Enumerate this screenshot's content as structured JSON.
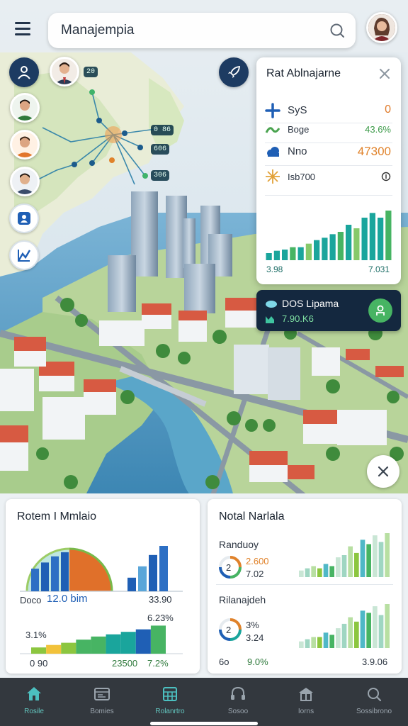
{
  "header": {
    "search_value": "Manajempia",
    "search_placeholder": "Manajempia"
  },
  "map": {
    "route_tags": [
      "20",
      "0 86",
      "606",
      "306"
    ],
    "side_buttons": [
      "pin-icon",
      "analytics-icon"
    ]
  },
  "info_panel": {
    "title": "Rat Ablnajarne",
    "rows": [
      {
        "icon": "cross-icon",
        "label": "SyS",
        "value": "0",
        "color": "#e07b2a"
      },
      {
        "icon": "trend-icon",
        "label": "Boge",
        "value": "43.6%",
        "color": "#3d9b4a"
      },
      {
        "icon": "cloud-icon",
        "label": "Nno",
        "value": "47300",
        "color": "#e0822a"
      },
      {
        "icon": "star-icon",
        "label": "Isb700",
        "value": "0",
        "color": "#333333"
      }
    ],
    "foot_left": "3.98",
    "foot_right": "7.031",
    "chart": [
      12,
      16,
      18,
      22,
      22,
      28,
      34,
      38,
      44,
      48,
      60,
      54,
      72,
      80,
      72,
      84
    ]
  },
  "dark_card": {
    "title": "DOS Lipama",
    "subtitle": "7.90.K6"
  },
  "left_card": {
    "title": "Rotem I Mmlaio",
    "caption_left": "Doco",
    "caption_mid": "12.0 bim",
    "caption_right": "33.90",
    "area_pct": "6.23%",
    "area_left": "3.1%",
    "foot_1": "0 90",
    "foot_2": "23500",
    "foot_3": "7.2%",
    "semi_bars": [
      0.55,
      0.7,
      0.85,
      0.95
    ],
    "right_bars": [
      0.3,
      0.55,
      0.8,
      1.0
    ],
    "area_values": [
      0.2,
      0.28,
      0.35,
      0.45,
      0.55,
      0.62,
      0.7,
      0.78,
      0.9
    ]
  },
  "right_card": {
    "title": "Notal Narlala",
    "section1_title": "Randuoy",
    "s1_ring": "2",
    "s1_val1": "2.600",
    "s1_val2": "7.02",
    "section2_title": "Rilanajdeh",
    "s2_ring": "2",
    "s2_val1": "3%",
    "s2_val2": "3.24",
    "foot_left": "6o",
    "foot_mid": "9.0%",
    "foot_right": "3.9.06",
    "bars1": [
      0.15,
      0.2,
      0.25,
      0.2,
      0.3,
      0.25,
      0.45,
      0.5,
      0.7,
      0.55,
      0.85,
      0.75,
      0.95,
      0.8,
      1.0
    ],
    "bars2": [
      0.15,
      0.2,
      0.25,
      0.25,
      0.35,
      0.3,
      0.45,
      0.55,
      0.7,
      0.6,
      0.85,
      0.8,
      0.95,
      0.75,
      1.0
    ]
  },
  "nav": {
    "items": [
      {
        "label": "Rosile",
        "icon": "home-icon"
      },
      {
        "label": "Bomies",
        "icon": "browser-icon"
      },
      {
        "label": "Rolanrtro",
        "icon": "grid-icon"
      },
      {
        "label": "Sosoo",
        "icon": "headset-icon"
      },
      {
        "label": "Iorns",
        "icon": "building-icon"
      },
      {
        "label": "Sossibrono",
        "icon": "search-icon"
      }
    ],
    "active_index": 2
  },
  "colors": {
    "navy": "#1d3b62",
    "teal": "#1aa59c",
    "green": "#47b463",
    "orange": "#e0822a",
    "blue": "#1f5fb5"
  }
}
